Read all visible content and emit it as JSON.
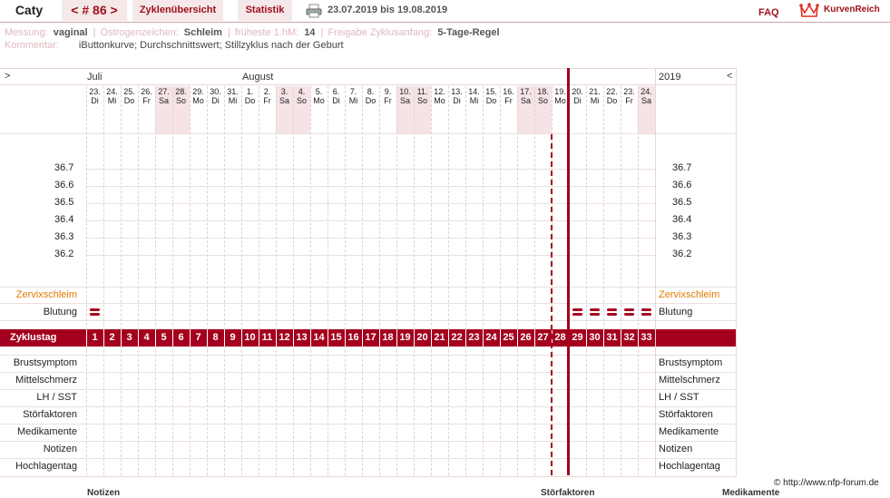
{
  "header": {
    "user": "Caty",
    "cycle_nav": "< # 86 >",
    "cycles_tab": "Zyklenübersicht",
    "stats_tab": "Statistik",
    "date_range": "23.07.2019 bis 19.08.2019",
    "faq": "FAQ",
    "brand": "KurvenReich"
  },
  "info": {
    "measurement_label": "Messung:",
    "measurement_value": "vaginal",
    "estrogen_label": "Östrogenzeichen:",
    "estrogen_value": "Schleim",
    "earliest_label": "früheste 1.hM:",
    "earliest_value": "14",
    "release_label": "Freigabe Zyklusanfang:",
    "release_value": "5-Tage-Regel",
    "comment_label": "Kommentar:",
    "comment_value": "iButtonkurve; Durchschnittswert; Stillzyklus nach der Geburt"
  },
  "chart": {
    "nav_prev": ">",
    "nav_next": "<",
    "month_1": "Juli",
    "month_2": "August",
    "year": "2019",
    "days": [
      {
        "d": "23.",
        "w": "Di",
        "we": false
      },
      {
        "d": "24.",
        "w": "Mi",
        "we": false
      },
      {
        "d": "25.",
        "w": "Do",
        "we": false
      },
      {
        "d": "26.",
        "w": "Fr",
        "we": false
      },
      {
        "d": "27.",
        "w": "Sa",
        "we": true
      },
      {
        "d": "28.",
        "w": "So",
        "we": true
      },
      {
        "d": "29.",
        "w": "Mo",
        "we": false
      },
      {
        "d": "30.",
        "w": "Di",
        "we": false
      },
      {
        "d": "31.",
        "w": "Mi",
        "we": false
      },
      {
        "d": "1.",
        "w": "Do",
        "we": false
      },
      {
        "d": "2.",
        "w": "Fr",
        "we": false
      },
      {
        "d": "3.",
        "w": "Sa",
        "we": true
      },
      {
        "d": "4.",
        "w": "So",
        "we": true
      },
      {
        "d": "5.",
        "w": "Mo",
        "we": false
      },
      {
        "d": "6.",
        "w": "Di",
        "we": false
      },
      {
        "d": "7.",
        "w": "Mi",
        "we": false
      },
      {
        "d": "8.",
        "w": "Do",
        "we": false
      },
      {
        "d": "9.",
        "w": "Fr",
        "we": false
      },
      {
        "d": "10.",
        "w": "Sa",
        "we": true
      },
      {
        "d": "11.",
        "w": "So",
        "we": true
      },
      {
        "d": "12.",
        "w": "Mo",
        "we": false
      },
      {
        "d": "13.",
        "w": "Di",
        "we": false
      },
      {
        "d": "14.",
        "w": "Mi",
        "we": false
      },
      {
        "d": "15.",
        "w": "Do",
        "we": false
      },
      {
        "d": "16.",
        "w": "Fr",
        "we": false
      },
      {
        "d": "17.",
        "w": "Sa",
        "we": true
      },
      {
        "d": "18.",
        "w": "So",
        "we": true
      },
      {
        "d": "19.",
        "w": "Mo",
        "we": false
      },
      {
        "d": "20.",
        "w": "Di",
        "we": false
      },
      {
        "d": "21.",
        "w": "Mi",
        "we": false
      },
      {
        "d": "22.",
        "w": "Do",
        "we": false
      },
      {
        "d": "23.",
        "w": "Fr",
        "we": false
      },
      {
        "d": "24.",
        "w": "Sa",
        "we": true
      }
    ],
    "temps": [
      "36.7",
      "36.6",
      "36.5",
      "36.4",
      "36.3",
      "36.2"
    ],
    "rows_top": {
      "cervix": "Zervixschleim",
      "bleeding": "Blutung"
    },
    "cycle_label": "Zyklustag",
    "cycle_days": [
      "1",
      "2",
      "3",
      "4",
      "5",
      "6",
      "7",
      "8",
      "9",
      "10",
      "11",
      "12",
      "13",
      "14",
      "15",
      "16",
      "17",
      "18",
      "19",
      "20",
      "21",
      "22",
      "23",
      "24",
      "25",
      "26",
      "27",
      "28",
      "29",
      "30",
      "31",
      "32",
      "33"
    ],
    "bleeding_days": [
      1,
      29,
      30,
      31,
      32,
      33
    ],
    "current_day": 29,
    "rows_bottom": [
      "Brustsymptom",
      "Mittelschmerz",
      "LH / SST",
      "Störfaktoren",
      "Medikamente",
      "Notizen",
      "Hochlagentag"
    ],
    "copyright": "© http://www.nfp-forum.de",
    "accent": "#a4001e",
    "cervix_color": "#e07a00"
  },
  "footer": {
    "notes": "Notizen",
    "disturb": "Störfaktoren",
    "meds": "Medikamente"
  }
}
